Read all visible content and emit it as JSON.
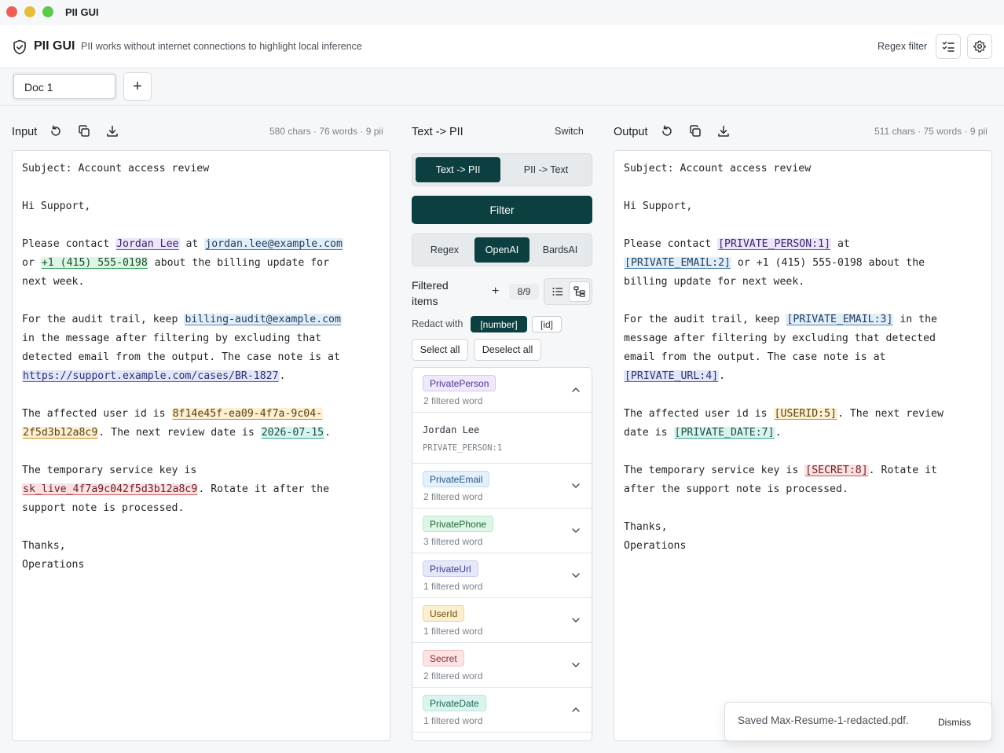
{
  "window": {
    "title": "PII GUI"
  },
  "app": {
    "name": "PII GUI",
    "description": "PII works without internet connections to highlight local inference",
    "regex_filter_label": "Regex filter",
    "icons": {
      "checklist": "checklist-icon",
      "settings": "gear-icon",
      "shield": "shield-check-icon"
    }
  },
  "tabs": {
    "items": [
      {
        "label": "Doc 1"
      }
    ],
    "add_label": "+"
  },
  "input": {
    "label": "Input",
    "stats": "580 chars · 76 words · 9 pii",
    "lines": [
      [
        {
          "t": "Subject: Account access review"
        }
      ],
      [
        {
          "t": ""
        }
      ],
      [
        {
          "t": "Hi Support,"
        }
      ],
      [
        {
          "t": ""
        }
      ],
      [
        {
          "t": "Please contact "
        },
        {
          "t": "Jordan Lee",
          "c": "person"
        },
        {
          "t": " at "
        },
        {
          "t": "jordan.lee@example.com",
          "c": "email"
        }
      ],
      [
        {
          "t": "or "
        },
        {
          "t": "+1 (415) 555-0198",
          "c": "phone"
        },
        {
          "t": " about the billing update for"
        }
      ],
      [
        {
          "t": "next week."
        }
      ],
      [
        {
          "t": ""
        }
      ],
      [
        {
          "t": "For the audit trail, keep "
        },
        {
          "t": "billing-audit@example.com",
          "c": "email"
        }
      ],
      [
        {
          "t": "in the message after filtering by excluding that"
        }
      ],
      [
        {
          "t": "detected email from the output. The case note is at"
        }
      ],
      [
        {
          "t": "https://support.example.com/cases/BR-1827",
          "c": "url"
        },
        {
          "t": "."
        }
      ],
      [
        {
          "t": ""
        }
      ],
      [
        {
          "t": "The affected user id is "
        },
        {
          "t": "8f14e45f-ea09-4f7a-9c04-",
          "c": "userid"
        }
      ],
      [
        {
          "t": "2f5d3b12a8c9",
          "c": "userid"
        },
        {
          "t": ". The next review date is "
        },
        {
          "t": "2026-07-15",
          "c": "date"
        },
        {
          "t": "."
        }
      ],
      [
        {
          "t": ""
        }
      ],
      [
        {
          "t": "The temporary service key is"
        }
      ],
      [
        {
          "t": "sk_live_4f7a9c042f5d3b12a8c9",
          "c": "secret"
        },
        {
          "t": ". Rotate it after the"
        }
      ],
      [
        {
          "t": "support note is processed."
        }
      ],
      [
        {
          "t": ""
        }
      ],
      [
        {
          "t": "Thanks,"
        }
      ],
      [
        {
          "t": "Operations"
        }
      ]
    ]
  },
  "middle": {
    "header_label": "Text -> PII",
    "switch_label": "Switch",
    "direction": {
      "options": [
        "Text -> PII",
        "PII -> Text"
      ],
      "active": 0
    },
    "filter_button": "Filter",
    "engines": {
      "options": [
        "Regex",
        "OpenAI",
        "BardsAI"
      ],
      "active": 1
    },
    "filtered_title": "Filtered items",
    "add_label": "+",
    "count": "8/9",
    "redact_label": "Redact with",
    "redact_options": [
      "[number]",
      "[id]"
    ],
    "select_all": "Select all",
    "deselect_all": "Deselect all",
    "groups": [
      {
        "name": "PrivatePerson",
        "count": "2 filtered word",
        "expanded": true,
        "bg": "#efe9fb",
        "fg": "#4b3590",
        "border": "#d5c8f2",
        "entries": [
          {
            "text": "Jordan Lee",
            "tag": "PRIVATE_PERSON:1"
          }
        ]
      },
      {
        "name": "PrivateEmail",
        "count": "2 filtered word",
        "expanded": false,
        "bg": "#e4f0fa",
        "fg": "#275683",
        "border": "#c4dcf0"
      },
      {
        "name": "PrivatePhone",
        "count": "3 filtered word",
        "expanded": false,
        "bg": "#ddf6e6",
        "fg": "#226a3c",
        "border": "#b7e7c8"
      },
      {
        "name": "PrivateUrl",
        "count": "1 filtered word",
        "expanded": false,
        "bg": "#e6e8f9",
        "fg": "#363f8c",
        "border": "#c9cdf1"
      },
      {
        "name": "UserId",
        "count": "1 filtered word",
        "expanded": false,
        "bg": "#fcefcf",
        "fg": "#6f4f0b",
        "border": "#f1d58e"
      },
      {
        "name": "Secret",
        "count": "2 filtered word",
        "expanded": false,
        "bg": "#fce3e4",
        "fg": "#8c2a32",
        "border": "#f3c1c5"
      },
      {
        "name": "PrivateDate",
        "count": "1 filtered word",
        "expanded": true,
        "bg": "#daf5ee",
        "fg": "#1c6253",
        "border": "#b2e7da"
      }
    ]
  },
  "output": {
    "label": "Output",
    "stats": "511 chars · 75 words · 9 pii",
    "lines": [
      [
        {
          "t": "Subject: Account access review"
        }
      ],
      [
        {
          "t": ""
        }
      ],
      [
        {
          "t": "Hi Support,"
        }
      ],
      [
        {
          "t": ""
        }
      ],
      [
        {
          "t": "Please contact "
        },
        {
          "t": "[PRIVATE_PERSON:1]",
          "c": "person"
        },
        {
          "t": " at"
        }
      ],
      [
        {
          "t": "[PRIVATE_EMAIL:2]",
          "c": "email"
        },
        {
          "t": " or +1 (415) 555-0198 about the"
        }
      ],
      [
        {
          "t": "billing update for next week."
        }
      ],
      [
        {
          "t": ""
        }
      ],
      [
        {
          "t": "For the audit trail, keep "
        },
        {
          "t": "[PRIVATE_EMAIL:3]",
          "c": "email"
        },
        {
          "t": " in the"
        }
      ],
      [
        {
          "t": "message after filtering by excluding that detected"
        }
      ],
      [
        {
          "t": "email from the output. The case note is at"
        }
      ],
      [
        {
          "t": "[PRIVATE_URL:4]",
          "c": "url"
        },
        {
          "t": "."
        }
      ],
      [
        {
          "t": ""
        }
      ],
      [
        {
          "t": "The affected user id is "
        },
        {
          "t": "[USERID:5]",
          "c": "userid"
        },
        {
          "t": ". The next review"
        }
      ],
      [
        {
          "t": "date is "
        },
        {
          "t": "[PRIVATE_DATE:7]",
          "c": "date"
        },
        {
          "t": "."
        }
      ],
      [
        {
          "t": ""
        }
      ],
      [
        {
          "t": "The temporary service key is "
        },
        {
          "t": "[SECRET:8]",
          "c": "secret"
        },
        {
          "t": ". Rotate it"
        }
      ],
      [
        {
          "t": "after the support note is processed."
        }
      ],
      [
        {
          "t": ""
        }
      ],
      [
        {
          "t": "Thanks,"
        }
      ],
      [
        {
          "t": "Operations"
        }
      ]
    ]
  },
  "toast": {
    "message": "Saved Max-Resume-1-redacted.pdf.",
    "dismiss": "Dismiss"
  }
}
